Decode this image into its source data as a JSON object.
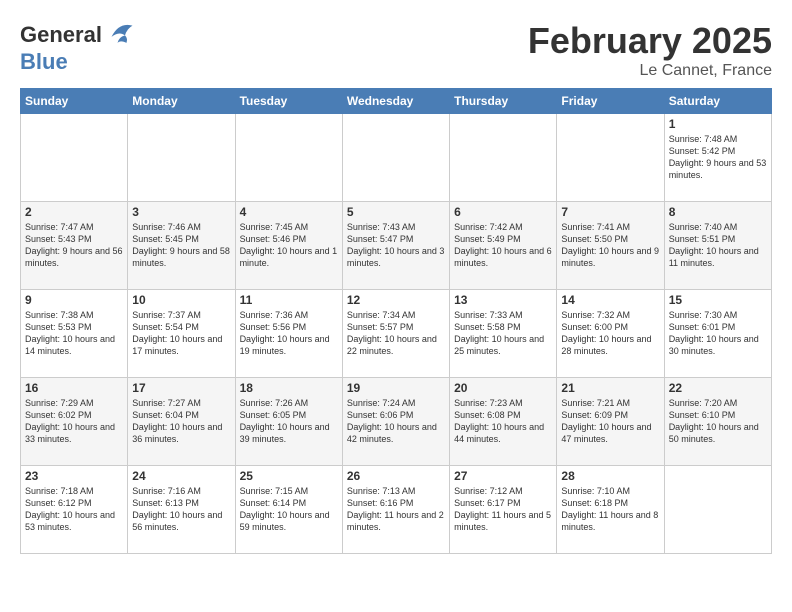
{
  "logo": {
    "line1": "General",
    "line2": "Blue"
  },
  "title": "February 2025",
  "subtitle": "Le Cannet, France",
  "days_of_week": [
    "Sunday",
    "Monday",
    "Tuesday",
    "Wednesday",
    "Thursday",
    "Friday",
    "Saturday"
  ],
  "weeks": [
    [
      {
        "day": "",
        "info": ""
      },
      {
        "day": "",
        "info": ""
      },
      {
        "day": "",
        "info": ""
      },
      {
        "day": "",
        "info": ""
      },
      {
        "day": "",
        "info": ""
      },
      {
        "day": "",
        "info": ""
      },
      {
        "day": "1",
        "info": "Sunrise: 7:48 AM\nSunset: 5:42 PM\nDaylight: 9 hours and 53 minutes."
      }
    ],
    [
      {
        "day": "2",
        "info": "Sunrise: 7:47 AM\nSunset: 5:43 PM\nDaylight: 9 hours and 56 minutes."
      },
      {
        "day": "3",
        "info": "Sunrise: 7:46 AM\nSunset: 5:45 PM\nDaylight: 9 hours and 58 minutes."
      },
      {
        "day": "4",
        "info": "Sunrise: 7:45 AM\nSunset: 5:46 PM\nDaylight: 10 hours and 1 minute."
      },
      {
        "day": "5",
        "info": "Sunrise: 7:43 AM\nSunset: 5:47 PM\nDaylight: 10 hours and 3 minutes."
      },
      {
        "day": "6",
        "info": "Sunrise: 7:42 AM\nSunset: 5:49 PM\nDaylight: 10 hours and 6 minutes."
      },
      {
        "day": "7",
        "info": "Sunrise: 7:41 AM\nSunset: 5:50 PM\nDaylight: 10 hours and 9 minutes."
      },
      {
        "day": "8",
        "info": "Sunrise: 7:40 AM\nSunset: 5:51 PM\nDaylight: 10 hours and 11 minutes."
      }
    ],
    [
      {
        "day": "9",
        "info": "Sunrise: 7:38 AM\nSunset: 5:53 PM\nDaylight: 10 hours and 14 minutes."
      },
      {
        "day": "10",
        "info": "Sunrise: 7:37 AM\nSunset: 5:54 PM\nDaylight: 10 hours and 17 minutes."
      },
      {
        "day": "11",
        "info": "Sunrise: 7:36 AM\nSunset: 5:56 PM\nDaylight: 10 hours and 19 minutes."
      },
      {
        "day": "12",
        "info": "Sunrise: 7:34 AM\nSunset: 5:57 PM\nDaylight: 10 hours and 22 minutes."
      },
      {
        "day": "13",
        "info": "Sunrise: 7:33 AM\nSunset: 5:58 PM\nDaylight: 10 hours and 25 minutes."
      },
      {
        "day": "14",
        "info": "Sunrise: 7:32 AM\nSunset: 6:00 PM\nDaylight: 10 hours and 28 minutes."
      },
      {
        "day": "15",
        "info": "Sunrise: 7:30 AM\nSunset: 6:01 PM\nDaylight: 10 hours and 30 minutes."
      }
    ],
    [
      {
        "day": "16",
        "info": "Sunrise: 7:29 AM\nSunset: 6:02 PM\nDaylight: 10 hours and 33 minutes."
      },
      {
        "day": "17",
        "info": "Sunrise: 7:27 AM\nSunset: 6:04 PM\nDaylight: 10 hours and 36 minutes."
      },
      {
        "day": "18",
        "info": "Sunrise: 7:26 AM\nSunset: 6:05 PM\nDaylight: 10 hours and 39 minutes."
      },
      {
        "day": "19",
        "info": "Sunrise: 7:24 AM\nSunset: 6:06 PM\nDaylight: 10 hours and 42 minutes."
      },
      {
        "day": "20",
        "info": "Sunrise: 7:23 AM\nSunset: 6:08 PM\nDaylight: 10 hours and 44 minutes."
      },
      {
        "day": "21",
        "info": "Sunrise: 7:21 AM\nSunset: 6:09 PM\nDaylight: 10 hours and 47 minutes."
      },
      {
        "day": "22",
        "info": "Sunrise: 7:20 AM\nSunset: 6:10 PM\nDaylight: 10 hours and 50 minutes."
      }
    ],
    [
      {
        "day": "23",
        "info": "Sunrise: 7:18 AM\nSunset: 6:12 PM\nDaylight: 10 hours and 53 minutes."
      },
      {
        "day": "24",
        "info": "Sunrise: 7:16 AM\nSunset: 6:13 PM\nDaylight: 10 hours and 56 minutes."
      },
      {
        "day": "25",
        "info": "Sunrise: 7:15 AM\nSunset: 6:14 PM\nDaylight: 10 hours and 59 minutes."
      },
      {
        "day": "26",
        "info": "Sunrise: 7:13 AM\nSunset: 6:16 PM\nDaylight: 11 hours and 2 minutes."
      },
      {
        "day": "27",
        "info": "Sunrise: 7:12 AM\nSunset: 6:17 PM\nDaylight: 11 hours and 5 minutes."
      },
      {
        "day": "28",
        "info": "Sunrise: 7:10 AM\nSunset: 6:18 PM\nDaylight: 11 hours and 8 minutes."
      },
      {
        "day": "",
        "info": ""
      }
    ]
  ]
}
